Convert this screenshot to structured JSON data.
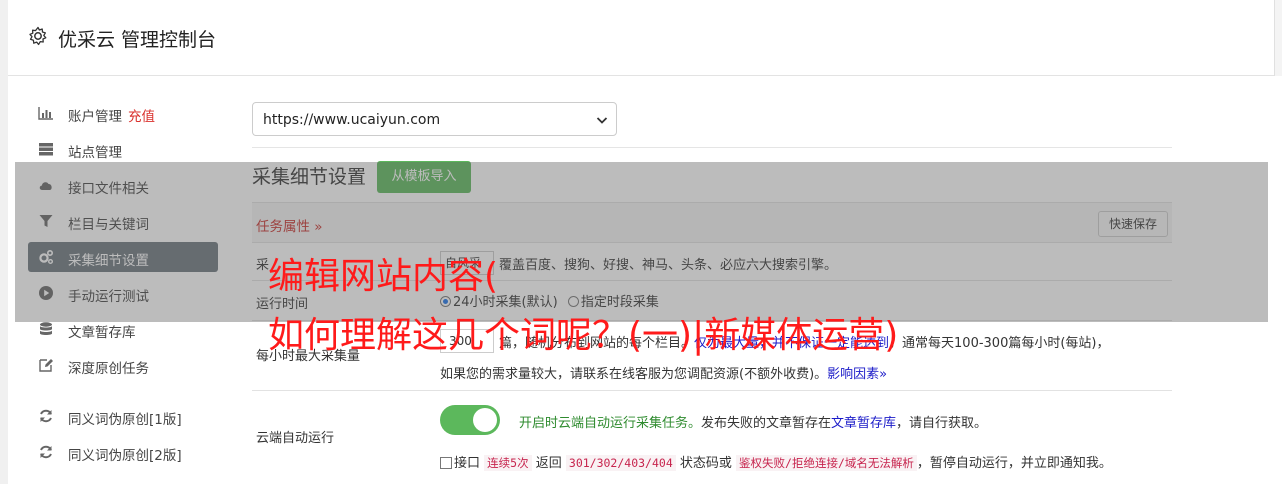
{
  "header": {
    "title": "优采云 管理控制台"
  },
  "sidebar": {
    "items": [
      {
        "label": "账户管理",
        "badge": "充值",
        "icon": "bar-chart-icon"
      },
      {
        "label": "站点管理",
        "icon": "server-icon"
      },
      {
        "label": "接口文件相关",
        "icon": "cloud-upload-icon"
      },
      {
        "label": "栏目与关键词",
        "icon": "filter-icon"
      },
      {
        "label": "采集细节设置",
        "icon": "cogs-icon",
        "active": true
      },
      {
        "label": "手动运行测试",
        "icon": "play-circle-icon"
      },
      {
        "label": "文章暂存库",
        "icon": "database-icon"
      },
      {
        "label": "深度原创任务",
        "icon": "edit-icon"
      },
      {
        "label": "同义词伪原创[1版]",
        "icon": "refresh-icon"
      },
      {
        "label": "同义词伪原创[2版]",
        "icon": "refresh-icon"
      }
    ]
  },
  "main": {
    "site_select": {
      "value": "https://www.ucaiyun.com"
    },
    "section_title": "采集细节设置",
    "import_button": "从模板导入",
    "task_attr": "任务属性",
    "quick_save": "快速保存",
    "engine": {
      "label": "采",
      "input": "自风采",
      "desc": "覆盖百度、搜狗、好搜、神马、头条、必应六大搜索引擎。"
    },
    "run_time": {
      "label": "运行时间",
      "option1": "24小时采集(默认)",
      "option2": "指定时段采集"
    },
    "max_per_hour": {
      "label": "每小时最大采集量",
      "value": "300",
      "desc_part1": "篇，随机分布到网站的每个栏目。",
      "desc_blue": "仅为最大量，并不保证一定能达到",
      "desc_part2": "，通常每天100-300篇每小时(每站)，",
      "line2": "如果您的需求量较大，请联系在线客服为您调配资源(不额外收费)。",
      "link": "影响因素"
    },
    "cloud_auto": {
      "label": "云端自动运行",
      "toggle_text": "开启时云端自动运行采集任务。",
      "text2": "发布失败的文章暂存在",
      "link": "文章暂存库",
      "text3": "，请自行获取。",
      "check_prefix": "接口",
      "code1": "连续5次",
      "t1": "返回",
      "code2": "301/302/403/404",
      "t2": "状态码或",
      "code3": "鉴权失败/拒绝连接/域名无法解析",
      "t3": "，暂停自动运行，并立即通知我。"
    }
  },
  "watermark": {
    "line1": "编辑网站内容(",
    "line2": "如何理解这几个词呢？(一)|新媒体运营)"
  }
}
